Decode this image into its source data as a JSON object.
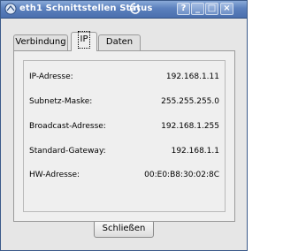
{
  "window": {
    "title": "eth1 Schnittstellen Status",
    "buttons": {
      "help": "?",
      "minimize": "_",
      "maximize": "□",
      "close": "×"
    }
  },
  "tabs": [
    {
      "label": "Verbindung",
      "active": false
    },
    {
      "label": "IP",
      "active": true
    },
    {
      "label": "Daten",
      "active": false
    }
  ],
  "details": [
    {
      "key": "IP-Adresse:",
      "value": "192.168.1.11"
    },
    {
      "key": "Subnetz-Maske:",
      "value": "255.255.255.0"
    },
    {
      "key": "Broadcast-Adresse:",
      "value": "192.168.1.255"
    },
    {
      "key": "Standard-Gateway:",
      "value": "192.168.1.1"
    },
    {
      "key": "HW-Adresse:",
      "value": "00:E0:B8:30:02:8C"
    }
  ],
  "footer": {
    "close_label": "Schließen"
  },
  "colors": {
    "titlebar": "#5b80bd",
    "window_bg": "#e6e6e6",
    "panel_bg": "#efefef"
  }
}
